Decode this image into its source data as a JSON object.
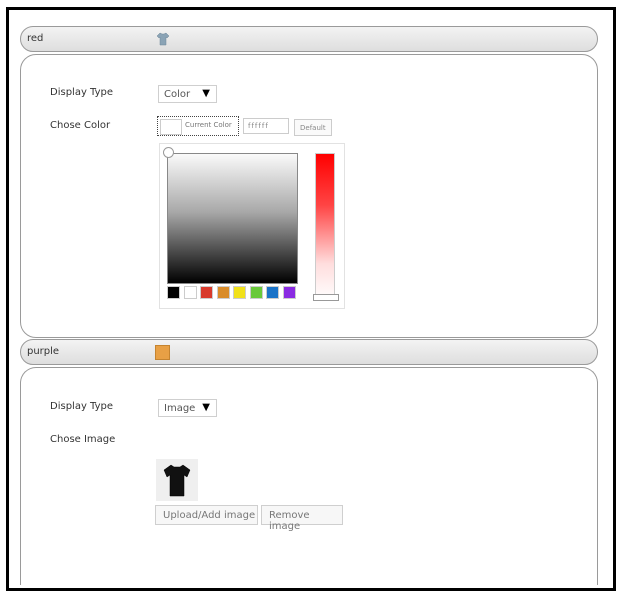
{
  "sections": [
    {
      "name": "red",
      "fields": {
        "display_type_label": "Display Type",
        "display_type_value": "Color",
        "chose_label": "Chose Color",
        "current_color_text": "Current Color",
        "hex_text": "ffffff",
        "default_text": "Default"
      }
    },
    {
      "name": "purple",
      "fields": {
        "display_type_label": "Display Type",
        "display_type_value": "Image",
        "chose_label": "Chose Image"
      },
      "buttons": {
        "upload": "Upload/Add image",
        "remove": "Remove image"
      }
    }
  ],
  "palette": [
    "#000000",
    "#ffffff",
    "#d83a2c",
    "#d98c2a",
    "#f1e11a",
    "#69c93a",
    "#1a73c8",
    "#8a2be2"
  ],
  "icons": {
    "red_header_icon": "tshirt-icon",
    "dropdown_arrow": "caret-down-icon"
  },
  "colors": {
    "purple_swatch": "#e8a045",
    "hue_top": "#ff0000"
  }
}
